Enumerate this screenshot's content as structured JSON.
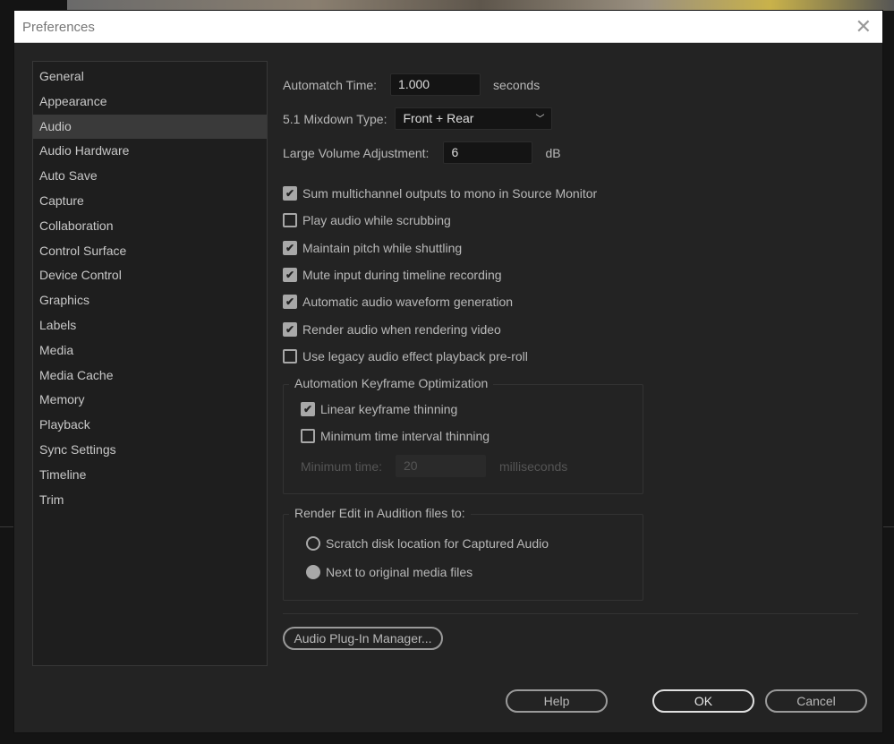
{
  "dialog": {
    "title": "Preferences"
  },
  "sidebar": {
    "items": [
      "General",
      "Appearance",
      "Audio",
      "Audio Hardware",
      "Auto Save",
      "Capture",
      "Collaboration",
      "Control Surface",
      "Device Control",
      "Graphics",
      "Labels",
      "Media",
      "Media Cache",
      "Memory",
      "Playback",
      "Sync Settings",
      "Timeline",
      "Trim"
    ],
    "selected": "Audio"
  },
  "audio": {
    "automatch_label": "Automatch Time:",
    "automatch_value": "1.000",
    "automatch_unit": "seconds",
    "mixdown_label": "5.1 Mixdown Type:",
    "mixdown_value": "Front + Rear",
    "volume_label": "Large Volume Adjustment:",
    "volume_value": "6",
    "volume_unit": "dB",
    "checkboxes": [
      {
        "label": "Sum multichannel outputs to mono in Source Monitor",
        "checked": true
      },
      {
        "label": "Play audio while scrubbing",
        "checked": false
      },
      {
        "label": "Maintain pitch while shuttling",
        "checked": true
      },
      {
        "label": "Mute input during timeline recording",
        "checked": true
      },
      {
        "label": "Automatic audio waveform generation",
        "checked": true
      },
      {
        "label": "Render audio when rendering video",
        "checked": true
      },
      {
        "label": "Use legacy audio effect playback pre-roll",
        "checked": false
      }
    ],
    "keyframe": {
      "title": "Automation Keyframe Optimization",
      "linear": "Linear keyframe thinning",
      "linear_checked": true,
      "interval": "Minimum time interval thinning",
      "interval_checked": false,
      "min_label": "Minimum time:",
      "min_value": "20",
      "min_unit": "milliseconds"
    },
    "render": {
      "title": "Render Edit in Audition files to:",
      "option1": "Scratch disk location for Captured Audio",
      "option2": "Next to original media files",
      "selected": "Next to original media files"
    },
    "plugin_button": "Audio Plug-In Manager..."
  },
  "footer": {
    "help": "Help",
    "ok": "OK",
    "cancel": "Cancel"
  }
}
